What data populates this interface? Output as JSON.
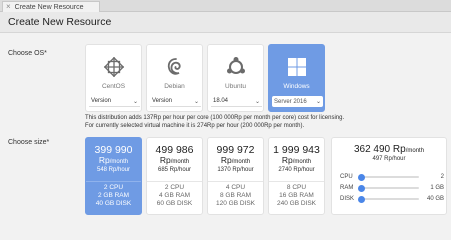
{
  "tab": {
    "title": "Create New Resource",
    "close": "×"
  },
  "header": {
    "title": "Create New Resource"
  },
  "os_section": {
    "label": "Choose OS*",
    "options": [
      {
        "name": "CentOS",
        "icon": "centos-icon",
        "select": "Version",
        "selected": false
      },
      {
        "name": "Debian",
        "icon": "debian-icon",
        "select": "Version",
        "selected": false
      },
      {
        "name": "Ubuntu",
        "icon": "ubuntu-icon",
        "select": "18.04",
        "selected": false
      },
      {
        "name": "Windows",
        "icon": "windows-icon",
        "select": "Server 2016",
        "selected": true
      }
    ],
    "note_line1": "This distribution adds 137Rp per hour per core (100 000Rp per month per core) cost for licensing.",
    "note_line2": "For currently selected virtual machine it is 274Rp per hour (200 000Rp per month)."
  },
  "size_section": {
    "label": "Choose size*",
    "plans": [
      {
        "price": "399 990",
        "unit": "Rp",
        "per_month": "/month",
        "per_hour": "548 Rp/hour",
        "cpu": "2 CPU",
        "ram": "2 GB RAM",
        "disk": "40 GB DISK",
        "selected": true
      },
      {
        "price": "499 986",
        "unit": "Rp",
        "per_month": "/month",
        "per_hour": "685 Rp/hour",
        "cpu": "2 CPU",
        "ram": "4 GB RAM",
        "disk": "60 GB DISK",
        "selected": false
      },
      {
        "price": "999 972",
        "unit": "Rp",
        "per_month": "/month",
        "per_hour": "1370 Rp/hour",
        "cpu": "4 CPU",
        "ram": "8 GB RAM",
        "disk": "120 GB DISK",
        "selected": false
      },
      {
        "price": "1 999 943",
        "unit": "Rp",
        "per_month": "/month",
        "per_hour": "2740 Rp/hour",
        "cpu": "8 CPU",
        "ram": "16 GB RAM",
        "disk": "240 GB DISK",
        "selected": false
      }
    ],
    "custom": {
      "price": "362 490",
      "unit": "Rp",
      "per_month": "/month",
      "per_hour": "497 Rp/hour",
      "sliders": [
        {
          "name": "CPU",
          "value": "2",
          "level": 0.0
        },
        {
          "name": "RAM",
          "value": "1 GB",
          "level": 0.0
        },
        {
          "name": "DISK",
          "value": "40 GB",
          "level": 0.0
        }
      ]
    }
  },
  "colors": {
    "accent": "#6f9be4",
    "slider": "#4a86e8"
  }
}
